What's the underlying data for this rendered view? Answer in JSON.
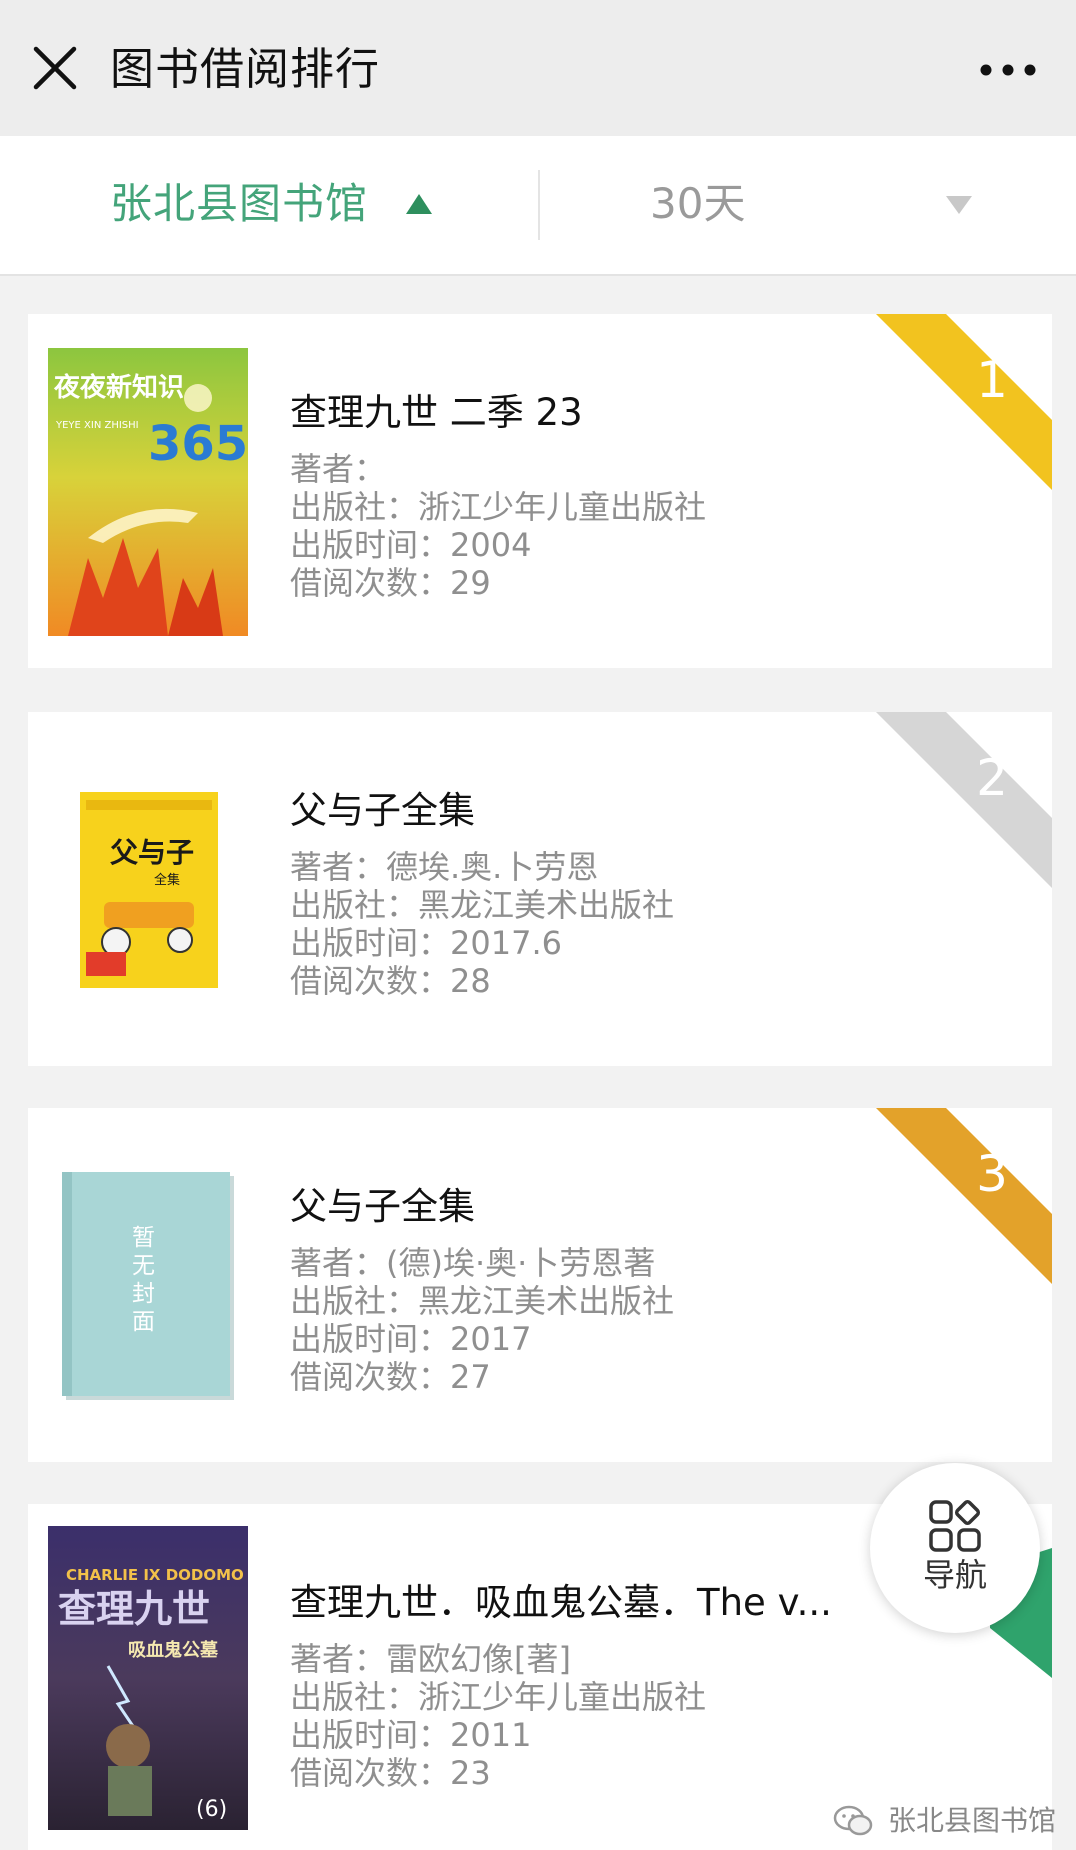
{
  "header": {
    "title": "图书借阅排行"
  },
  "filters": {
    "library": "张北县图书馆",
    "period": "30天"
  },
  "colors": {
    "accent_green": "#44a47a",
    "rank_1": "#f2c31f",
    "rank_2": "#d6d6d6",
    "rank_3": "#e3a22a",
    "nav_ribbon": "#2fa36c"
  },
  "books": [
    {
      "rank": "1",
      "title": "查理九世 二季 23",
      "author": "著者：",
      "publisher": "出版社：浙江少年儿童出版社",
      "year": "出版时间：2004",
      "loans": "借阅次数：29",
      "cover": {
        "type": "image",
        "text_main": "夜夜新知识",
        "text_number": "365",
        "text_pinyin": "YEYE XIN ZHISHI"
      }
    },
    {
      "rank": "2",
      "title": "父与子全集",
      "author": "著者：德埃.奥.卜劳恩",
      "publisher": "出版社：黑龙江美术出版社",
      "year": "出版时间：2017.6",
      "loans": "借阅次数：28",
      "cover": {
        "type": "image",
        "text_main": "父与子",
        "text_sub": "全集"
      }
    },
    {
      "rank": "3",
      "title": "父与子全集",
      "author": "著者：(德)埃·奥·卜劳恩著",
      "publisher": "出版社：黑龙江美术出版社",
      "year": "出版时间：2017",
      "loans": "借阅次数：27",
      "cover": {
        "type": "placeholder",
        "text_main": "暂无封面"
      }
    },
    {
      "rank": "",
      "title": "查理九世．吸血鬼公墓．The v...",
      "author": "著者：雷欧幻像[著]",
      "publisher": "出版社：浙江少年儿童出版社",
      "year": "出版时间：2011",
      "loans": "借阅次数：23",
      "cover": {
        "type": "image",
        "text_main": "查理九世",
        "text_latin": "CHARLIE IX DODOMO",
        "text_sub": "吸血鬼公墓",
        "text_number": "(6)"
      }
    }
  ],
  "nav_button": {
    "label": "导航",
    "icon": "grid-nav-icon"
  },
  "watermark": {
    "text": "张北县图书馆",
    "icon": "wechat-icon"
  }
}
